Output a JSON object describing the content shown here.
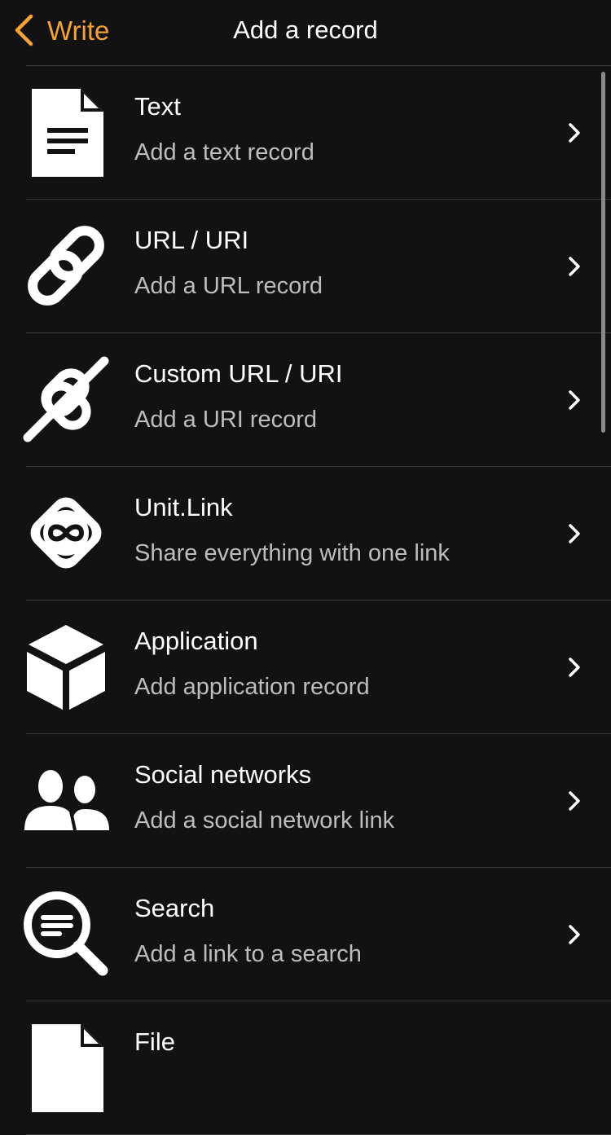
{
  "nav": {
    "back_label": "Write",
    "title": "Add a record",
    "accent_color": "#F5A230"
  },
  "records": [
    {
      "title": "Text",
      "subtitle": "Add a text record",
      "icon": "document-text-icon"
    },
    {
      "title": "URL / URI",
      "subtitle": "Add a URL record",
      "icon": "link-icon"
    },
    {
      "title": "Custom URL / URI",
      "subtitle": "Add a URI record",
      "icon": "custom-link-icon"
    },
    {
      "title": "Unit.Link",
      "subtitle": "Share everything with one link",
      "icon": "unitlink-icon"
    },
    {
      "title": "Application",
      "subtitle": "Add application record",
      "icon": "cube-icon"
    },
    {
      "title": "Social networks",
      "subtitle": "Add a social network link",
      "icon": "people-icon"
    },
    {
      "title": "Search",
      "subtitle": "Add a link to a search",
      "icon": "search-icon"
    },
    {
      "title": "File",
      "subtitle": "",
      "icon": "file-icon"
    }
  ]
}
